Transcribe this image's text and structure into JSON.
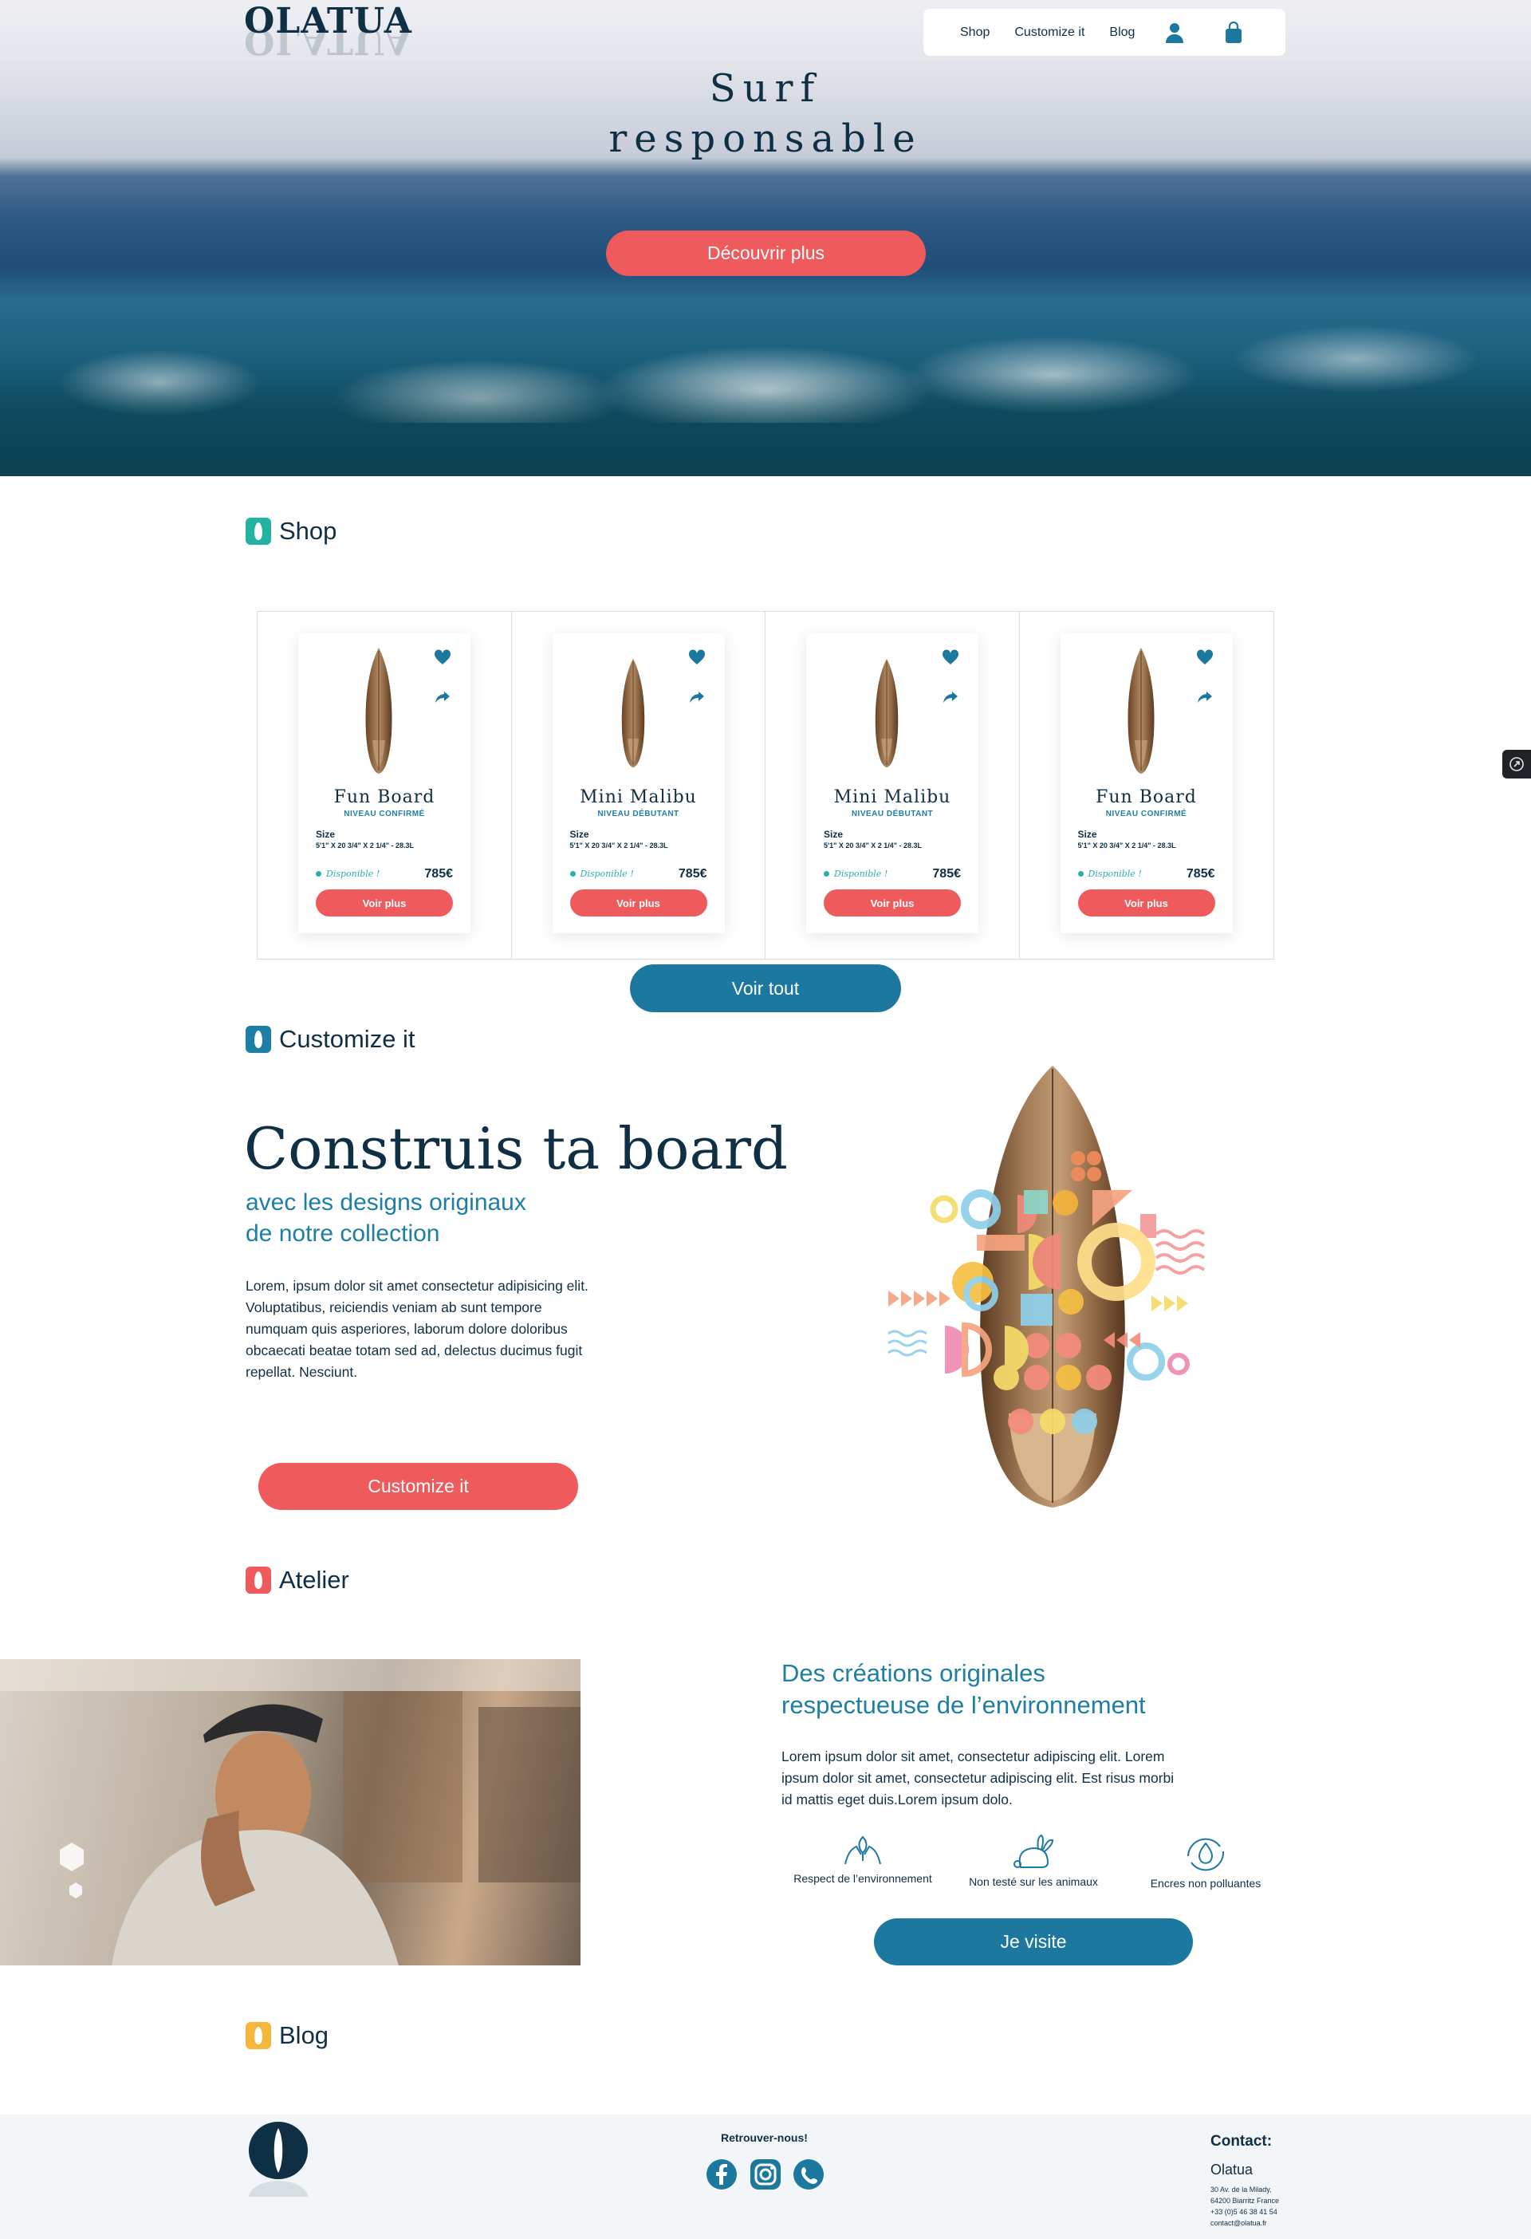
{
  "brand": {
    "logo_text": "OLATUA"
  },
  "nav": {
    "links": [
      "Shop",
      "Customize it",
      "Blog"
    ],
    "icons": [
      "user-icon",
      "shopping-bag-icon"
    ]
  },
  "hero": {
    "title_line1": "Surf",
    "title_line2": "responsable",
    "cta_label": "Découvrir plus"
  },
  "sections": {
    "shop": "Shop",
    "customize": "Customize it",
    "atelier": "Atelier",
    "blog": "Blog"
  },
  "shop": {
    "products": [
      {
        "name": "Fun Board",
        "level": "NIVEAU CONFIRMÉ",
        "size_label": "Size",
        "size": "5'1\" X 20 3/4\" X 2 1/4\" - 28.3L",
        "availability": "Disponible !",
        "price": "785€",
        "button": "Voir plus"
      },
      {
        "name": "Mini Malibu",
        "level": "NIVEAU DÉBUTANT",
        "size_label": "Size",
        "size": "5'1\" X 20 3/4\" X 2 1/4\" - 28.3L",
        "availability": "Disponible !",
        "price": "785€",
        "button": "Voir plus"
      },
      {
        "name": "Mini Malibu",
        "level": "NIVEAU DÉBUTANT",
        "size_label": "Size",
        "size": "5'1\" X 20 3/4\" X 2 1/4\" - 28.3L",
        "availability": "Disponible !",
        "price": "785€",
        "button": "Voir plus"
      },
      {
        "name": "Fun Board",
        "level": "NIVEAU CONFIRMÉ",
        "size_label": "Size",
        "size": "5'1\" X 20 3/4\" X 2 1/4\" - 28.3L",
        "availability": "Disponible !",
        "price": "785€",
        "button": "Voir plus"
      }
    ],
    "see_all": "Voir tout"
  },
  "customize": {
    "title": "Construis ta board",
    "subtitle_line1": "avec les designs originaux",
    "subtitle_line2": "de notre collection",
    "body": "Lorem, ipsum dolor sit amet consectetur adipisicing elit. Voluptatibus, reiciendis veniam ab sunt tempore numquam quis asperiores, laborum dolore doloribus obcaecati beatae totam sed ad, delectus ducimus fugit repellat. Nesciunt.",
    "button": "Customize it"
  },
  "atelier": {
    "title_line1": "Des créations originales",
    "title_line2": "respectueuse de l’environnement",
    "body": "Lorem ipsum dolor sit amet, consectetur adipiscing elit. Lorem ipsum dolor sit amet, consectetur adipiscing elit. Est risus morbi id mattis eget duis.Lorem ipsum dolo.",
    "badges": [
      "Respect de l’environnement",
      "Non testé sur les animaux",
      "Encres non polluantes"
    ],
    "button": "Je visite"
  },
  "footer": {
    "find_us": "Retrouver-nous!",
    "socials": [
      "facebook-icon",
      "instagram-icon",
      "whatsapp-icon"
    ],
    "contact_label": "Contact:",
    "company": "Olatua",
    "address_line1": "30 Av. de la Milady,",
    "address_line2": "64200 Biarritz France",
    "phone": "+33 (0)5 46 38 41 54",
    "email": "contact@olatua.fr"
  },
  "colors": {
    "navy": "#0f2f45",
    "teal_blue": "#1d789f",
    "coral": "#ef5a5d",
    "teal": "#2aaeb0",
    "shop_icon": "#22b3a3",
    "customize_icon": "#1e7fa4",
    "atelier_icon": "#ef5a5d",
    "blog_icon": "#f4b63b"
  }
}
